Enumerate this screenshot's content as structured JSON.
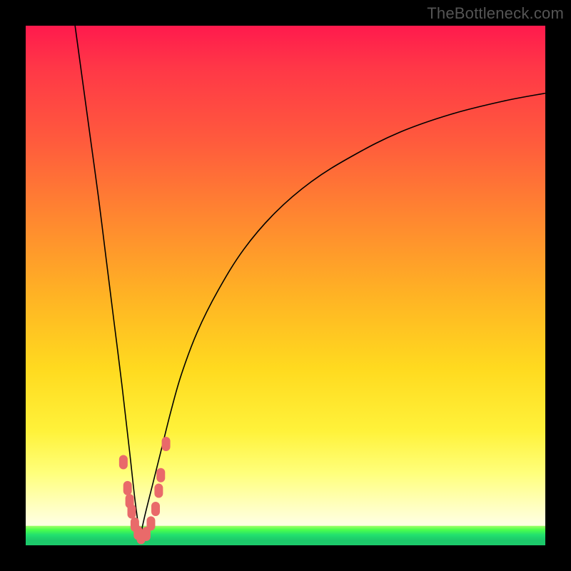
{
  "watermark": "TheBottleneck.com",
  "colors": {
    "frame": "#000000",
    "gradient_top": "#ff1a4d",
    "gradient_mid": "#ffda1f",
    "gradient_bottom_pale": "#ffffe0",
    "gradient_green": "#1cc96a",
    "curve": "#000000",
    "marker": "#e96a6a"
  },
  "chart_data": {
    "type": "line",
    "title": "",
    "xlabel": "",
    "ylabel": "",
    "xlim": [
      0,
      100
    ],
    "ylim": [
      0,
      100
    ],
    "grid": false,
    "legend": false,
    "min_x": 22,
    "series": [
      {
        "name": "left_branch",
        "x": [
          9.5,
          11,
          12.5,
          14,
          15.5,
          17,
          18.5,
          20,
          21,
          22
        ],
        "y": [
          100,
          89,
          78,
          67,
          55,
          43,
          31,
          18,
          9,
          1.5
        ]
      },
      {
        "name": "right_branch",
        "x": [
          22,
          23,
          24.5,
          26,
          28,
          30,
          33,
          37,
          42,
          48,
          55,
          63,
          72,
          82,
          92,
          100
        ],
        "y": [
          1.5,
          6,
          12,
          18,
          26,
          33,
          41,
          49,
          57,
          64,
          70,
          75,
          79.5,
          83,
          85.5,
          87
        ]
      }
    ],
    "markers": {
      "name": "highlighted_points",
      "shape": "rounded",
      "color": "#e96a6a",
      "points": [
        {
          "x": 18.8,
          "y": 16
        },
        {
          "x": 19.6,
          "y": 11
        },
        {
          "x": 20.0,
          "y": 8.5
        },
        {
          "x": 20.4,
          "y": 6.5
        },
        {
          "x": 21.0,
          "y": 4.0
        },
        {
          "x": 21.6,
          "y": 2.4
        },
        {
          "x": 22.2,
          "y": 1.6
        },
        {
          "x": 23.2,
          "y": 2.2
        },
        {
          "x": 24.1,
          "y": 4.2
        },
        {
          "x": 25.0,
          "y": 7.0
        },
        {
          "x": 25.6,
          "y": 10.5
        },
        {
          "x": 26.0,
          "y": 13.5
        },
        {
          "x": 27.0,
          "y": 19.5
        }
      ]
    }
  }
}
